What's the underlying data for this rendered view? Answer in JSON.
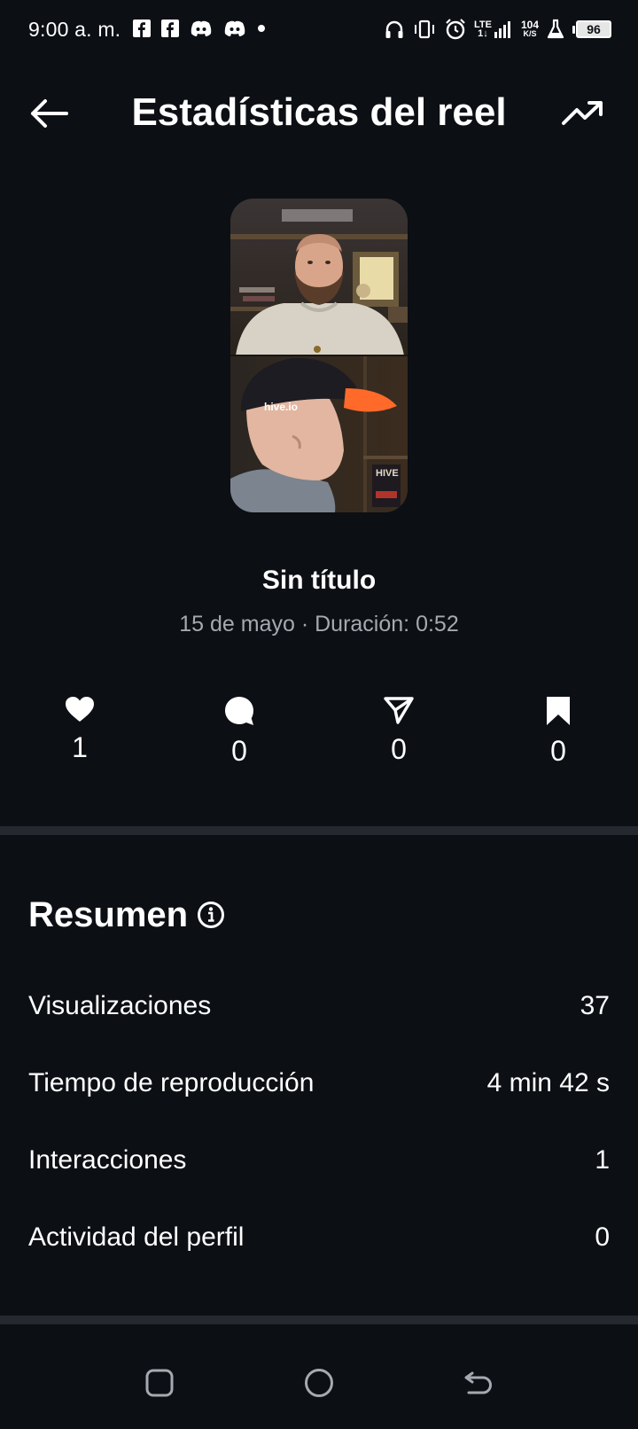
{
  "status_bar": {
    "time": "9:00 a. m.",
    "network_type": "LTE",
    "network_sub": "1↓",
    "speed_value": "104",
    "speed_unit": "K/S",
    "battery": "96"
  },
  "header": {
    "title": "Estadísticas del reel"
  },
  "reel": {
    "title": "Sin título",
    "meta": "15 de mayo · Duración: 0:52",
    "thumbnail_text": "hive.io",
    "poster_text": "HIVE"
  },
  "metrics": [
    {
      "icon": "heart-icon",
      "value": "1"
    },
    {
      "icon": "comment-icon",
      "value": "0"
    },
    {
      "icon": "share-icon",
      "value": "0"
    },
    {
      "icon": "bookmark-icon",
      "value": "0"
    }
  ],
  "summary": {
    "title": "Resumen",
    "rows": [
      {
        "label": "Visualizaciones",
        "value": "37"
      },
      {
        "label": "Tiempo de reproducción",
        "value": "4 min 42 s"
      },
      {
        "label": "Interacciones",
        "value": "1"
      },
      {
        "label": "Actividad del perfil",
        "value": "0"
      }
    ]
  },
  "colors": {
    "background": "#0c0f14",
    "divider": "#25282e",
    "secondary_text": "#a6a9b0"
  }
}
